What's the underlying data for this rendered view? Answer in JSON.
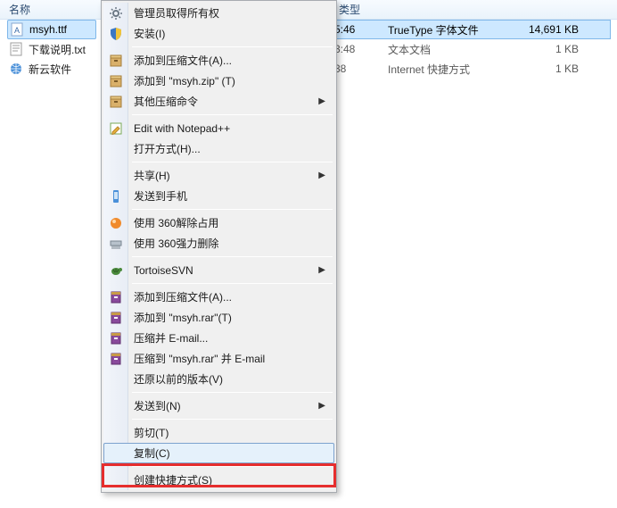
{
  "header": {
    "col1": "名称",
    "col2": "类型"
  },
  "files": [
    {
      "name": "msyh.ttf",
      "icon": "font-file",
      "date": "5:46",
      "type": "TrueType 字体文件",
      "size": "14,691 KB",
      "selected": true
    },
    {
      "name": "下载说明.txt",
      "icon": "txt-file",
      "date": "3:48",
      "type": "文本文档",
      "size": "1 KB",
      "selected": false
    },
    {
      "name": "新云软件",
      "icon": "url-file",
      "date": "38",
      "type": "Internet 快捷方式",
      "size": "1 KB",
      "selected": false
    }
  ],
  "menu": {
    "items": [
      {
        "label": "管理员取得所有权",
        "icon": "gear",
        "sep": false
      },
      {
        "label": "安装(I)",
        "icon": "shield",
        "sep": true
      },
      {
        "label": "添加到压缩文件(A)...",
        "icon": "archive",
        "sep": false
      },
      {
        "label": "添加到 \"msyh.zip\" (T)",
        "icon": "archive",
        "sep": false
      },
      {
        "label": "其他压缩命令",
        "icon": "archive",
        "submenu": true,
        "sep": true
      },
      {
        "label": "Edit with Notepad++",
        "icon": "notepad",
        "sep": false
      },
      {
        "label": "打开方式(H)...",
        "icon": "",
        "sep": true
      },
      {
        "label": "共享(H)",
        "icon": "",
        "submenu": true,
        "sep": false
      },
      {
        "label": "发送到手机",
        "icon": "phone",
        "sep": true
      },
      {
        "label": "使用 360解除占用",
        "icon": "orange-ball",
        "sep": false
      },
      {
        "label": "使用 360强力删除",
        "icon": "shredder",
        "sep": true
      },
      {
        "label": "TortoiseSVN",
        "icon": "tortoise",
        "submenu": true,
        "sep": true
      },
      {
        "label": "添加到压缩文件(A)...",
        "icon": "rar",
        "sep": false
      },
      {
        "label": "添加到 \"msyh.rar\"(T)",
        "icon": "rar",
        "sep": false
      },
      {
        "label": "压缩并 E-mail...",
        "icon": "rar",
        "sep": false
      },
      {
        "label": "压缩到 \"msyh.rar\" 并 E-mail",
        "icon": "rar",
        "sep": false
      },
      {
        "label": "还原以前的版本(V)",
        "icon": "",
        "sep": true
      },
      {
        "label": "发送到(N)",
        "icon": "",
        "submenu": true,
        "sep": true
      },
      {
        "label": "剪切(T)",
        "icon": "",
        "sep": false
      },
      {
        "label": "复制(C)",
        "icon": "",
        "hovered": true,
        "sep": true
      },
      {
        "label": "创建快捷方式(S)",
        "icon": "",
        "sep": false
      }
    ]
  }
}
